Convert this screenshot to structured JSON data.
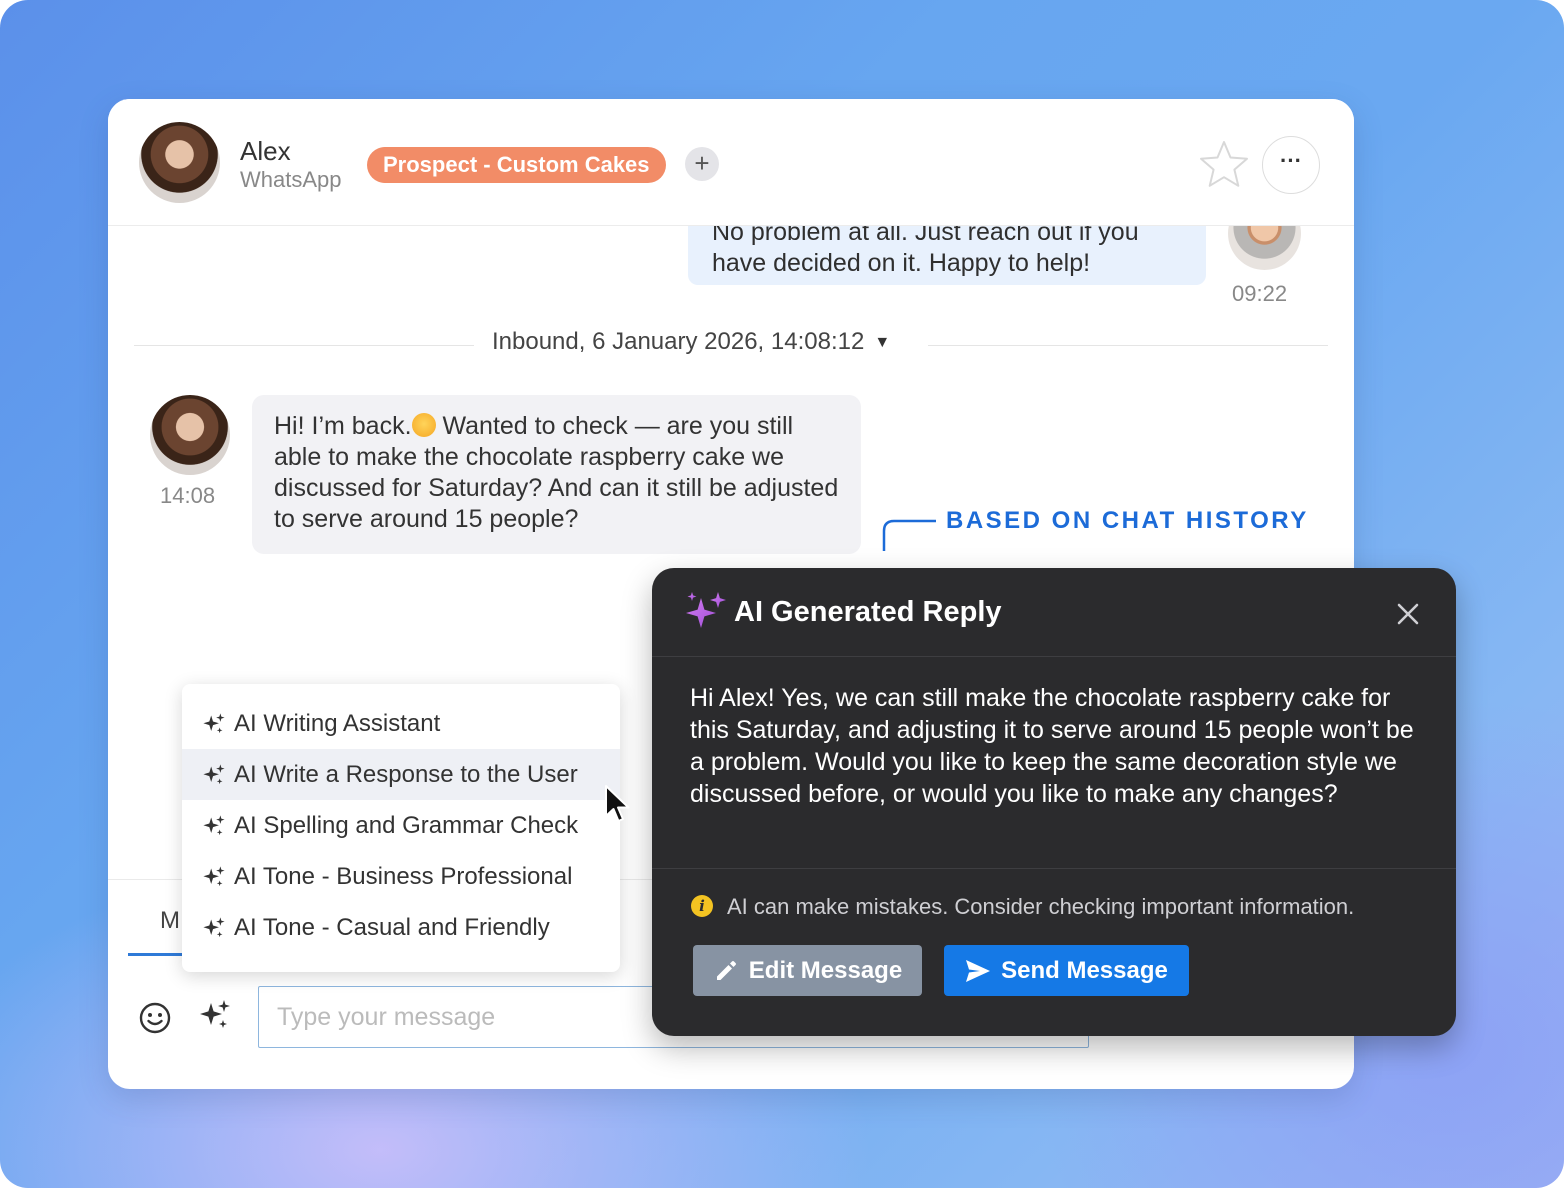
{
  "contact": {
    "name": "Alex",
    "channel": "WhatsApp",
    "tag": "Prospect - Custom Cakes",
    "add_tag": "+",
    "more": "···"
  },
  "messages": {
    "outbound": {
      "text": "No problem at all. Just reach out if you have decided on it. Happy to help!",
      "time": "09:22"
    },
    "divider": "Inbound, 6 January 2026, 14:08:12",
    "inbound": {
      "text_before_emoji": "Hi! I’m back.",
      "text_after_emoji": " Wanted to check — are you still able to make the chocolate raspberry cake we discussed for Saturday? And can it still be adjusted to serve around 15 people?",
      "time": "14:08"
    }
  },
  "composer": {
    "mode_tab": "M",
    "placeholder": "Type your message"
  },
  "ai_menu": {
    "items": [
      {
        "label": "AI Writing Assistant"
      },
      {
        "label": "AI Write a Response to the User"
      },
      {
        "label": "AI Spelling and Grammar Check"
      },
      {
        "label": "AI Tone - Business Professional"
      },
      {
        "label": "AI Tone - Casual and Friendly"
      }
    ],
    "active_index": 1
  },
  "callout": "BASED ON CHAT HISTORY",
  "ai_panel": {
    "title": "AI Generated Reply",
    "body": "Hi Alex! Yes, we can still make the chocolate raspberry cake for this Saturday, and adjusting it to serve around 15 people won’t be a problem. Would you like to keep the same decoration style we discussed before, or would you like to make any changes?",
    "disclaimer": "AI can make mistakes. Consider checking important information.",
    "edit_label": "Edit Message",
    "send_label": "Send Message"
  },
  "colors": {
    "tag": "#f28c67",
    "accent": "#1579e6",
    "callout": "#1c6bd8",
    "panel": "#2b2b2d",
    "ai_sparkle": "#b35ce0"
  },
  "icons": [
    "star-icon",
    "more-icon",
    "emoji-icon",
    "sparkle-icon",
    "close-icon",
    "info-icon",
    "pencil-icon",
    "send-icon",
    "cursor-icon"
  ]
}
